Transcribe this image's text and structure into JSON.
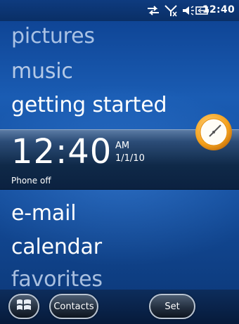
{
  "status_bar": {
    "time": "12:40",
    "icons": [
      "data-sync-icon",
      "no-signal-icon",
      "volume-icon",
      "battery-icon"
    ]
  },
  "menu": {
    "items": [
      {
        "label": "pictures"
      },
      {
        "label": "music"
      },
      {
        "label": "getting started"
      },
      {
        "label": "e-mail"
      },
      {
        "label": "calendar"
      },
      {
        "label": "favorites"
      }
    ]
  },
  "clock_panel": {
    "time": "12:40",
    "ampm": "AM",
    "date": "1/1/10",
    "status": "Phone off"
  },
  "softkeys": {
    "left": "Contacts",
    "right": "Set"
  },
  "colors": {
    "accent": "#1a5cb3",
    "band": "#0f2948",
    "clock_orange": "#f4a11c"
  }
}
